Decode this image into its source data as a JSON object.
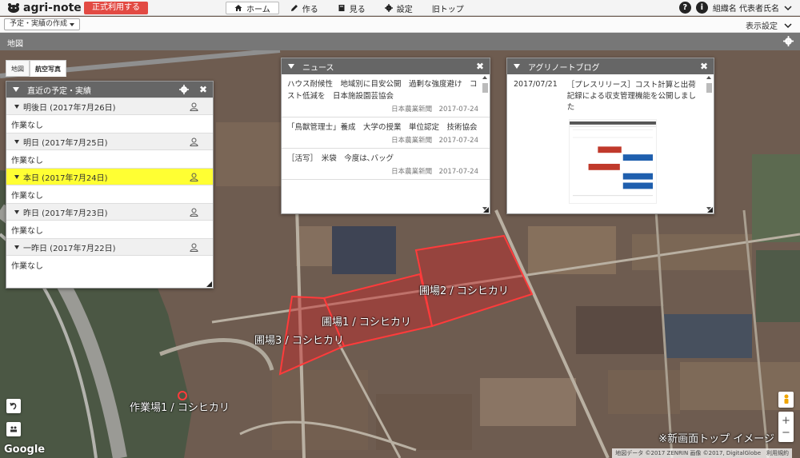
{
  "app": {
    "logo_text": "agri-note",
    "official_button": "正式利用する"
  },
  "nav": [
    {
      "label": "ホーム",
      "icon": "home-icon",
      "active": true
    },
    {
      "label": "作る",
      "icon": "pencil-icon"
    },
    {
      "label": "見る",
      "icon": "book-icon"
    },
    {
      "label": "設定",
      "icon": "gear-icon"
    },
    {
      "label": "旧トップ",
      "icon": ""
    }
  ],
  "header_right": {
    "help": "?",
    "info": "i",
    "org_name": "組織名 代表者氏名"
  },
  "subbar": {
    "create_button": "予定・実績の作成",
    "display_setting": "表示設定"
  },
  "mapbar": {
    "title": "地図"
  },
  "map_tabs": [
    {
      "label": "地図"
    },
    {
      "label": "航空写真",
      "active": true
    }
  ],
  "schedule_panel": {
    "title": "直近の予定・実績",
    "days": [
      {
        "label": "明後日 (2017年7月26日)",
        "body": "作業なし",
        "today": false
      },
      {
        "label": "明日 (2017年7月25日)",
        "body": "作業なし",
        "today": false
      },
      {
        "label": "本日 (2017年7月24日)",
        "body": "作業なし",
        "today": true
      },
      {
        "label": "昨日 (2017年7月23日)",
        "body": "作業なし",
        "today": false
      },
      {
        "label": "一昨日 (2017年7月22日)",
        "body": "作業なし",
        "today": false
      }
    ]
  },
  "news_panel": {
    "title": "ニュース",
    "items": [
      {
        "title": "ハウス耐候性　地域別に目安公開　過剰な強度避け　コスト低減を　日本施設園芸協会",
        "source": "日本農業新聞",
        "date": "2017-07-24"
      },
      {
        "title": "「鳥獣管理士」養成　大学の授業　単位認定　技術協会",
        "source": "日本農業新聞",
        "date": "2017-07-24"
      },
      {
        "title": "［活写］　米袋　今度は､バッグ",
        "source": "日本農業新聞",
        "date": "2017-07-24"
      }
    ]
  },
  "blog_panel": {
    "title": "アグリノートブログ",
    "date": "2017/07/21",
    "text": "［プレスリリース］コスト計算と出荷記録による収支管理機能を公開しました"
  },
  "fields": [
    {
      "label": "圃場1 / コシヒカリ"
    },
    {
      "label": "圃場2 / コシヒカリ"
    },
    {
      "label": "圃場3 / コシヒカリ"
    },
    {
      "label": "作業場1 / コシヒカリ"
    }
  ],
  "map_footer": {
    "google": "Google",
    "attribution": "地図データ ©2017 ZENRIN 画像 ©2017, DigitalGlobe　利用規約",
    "watermark": "※新画面トップ イメージ",
    "zoom_in": "+",
    "zoom_out": "−"
  },
  "colors": {
    "accent_red": "#e24a43",
    "today_yellow": "#ffff33",
    "header_gray": "#666666",
    "field_red": "#e53935"
  }
}
